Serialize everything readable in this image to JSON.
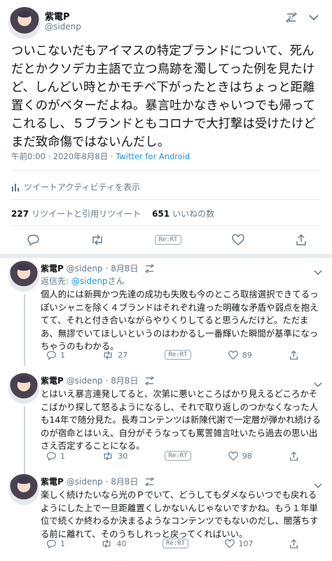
{
  "main_tweet": {
    "display_name": "紫電P",
    "handle": "@sidenp",
    "text": "ついこないだもアイマスの特定ブランドについて、死んだとかクソデカ主語で立つ鳥跡を濁してった例を見たけど、しんどい時とかモチベ下がったときはちょっと距離置くのがベターだよね。暴言吐かなきゃいつでも帰ってこれるし、５ブランドともコロナで大打撃は受けたけどまだ致命傷ではないんだし。",
    "time": "午前0:00 · 2020年8月8日 · ",
    "client": "Twitter for Android",
    "activity_label": "ツイートアクティビティを表示",
    "retweets_count": "227",
    "retweets_label": "リツイートと引用リツイート",
    "likes_count": "651",
    "likes_label": "いいねの数",
    "rert_label": "Re:RT"
  },
  "replies": [
    {
      "display_name": "紫電P",
      "handle": "@sidenp",
      "date": "· 8月8日",
      "reply_to_prefix": "返信先: ",
      "reply_to_handle": "@sidenp",
      "reply_to_suffix": "さん",
      "text": "個人的には新興かつ先達の成功も失敗も今のところ取捨選択できてるっぽいシャニを除く４ブランドはそれぞれ違った明確な矛盾や弱点を抱えてて、それと付き合いながらやりくりしてると思うんだけど。ただまあ、無謬でいてほしいというのはわかるし一番輝いた瞬間が基準になっちゃうのもわかる。",
      "reply_count": "1",
      "retweet_count": "27",
      "rert_label": "Re:RT",
      "like_count": "89"
    },
    {
      "display_name": "紫電P",
      "handle": "@sidenp",
      "date": "· 8月8日",
      "text": "とはいえ暴言連発してると、次第に悪いところばかり見えるどころかそこばかり探して怒るようになるし、それで取り返しのつかなくなった人も14年で随分見た。長寿コンテンツは新陳代謝で一定層が弾かれ続けるのが宿命とはいえ、自分がそうなっても罵詈雑言吐いたら過去の思い出さえ否定することになる。",
      "reply_count": "1",
      "retweet_count": "30",
      "rert_label": "Re:RT",
      "like_count": "98"
    },
    {
      "display_name": "紫電P",
      "handle": "@sidenp",
      "date": "· 8月8日",
      "text": "楽しく続けたいなら光のＰでいて、どうしてもダメならいつでも戻れるようにした上で一旦距離置くしかないんじゃないですかね。もう１年単位で続くか終わるか決まるようなコンテンツでもないのだし、闇落ちする前に離れて、そのうちしれっと戻ってくればいい。",
      "reply_count": "1",
      "retweet_count": "40",
      "rert_label": "Re:RT",
      "like_count": "107"
    }
  ],
  "colors": {
    "link": "#1b95e0",
    "muted": "#657786",
    "divider": "#e6ecf0"
  }
}
